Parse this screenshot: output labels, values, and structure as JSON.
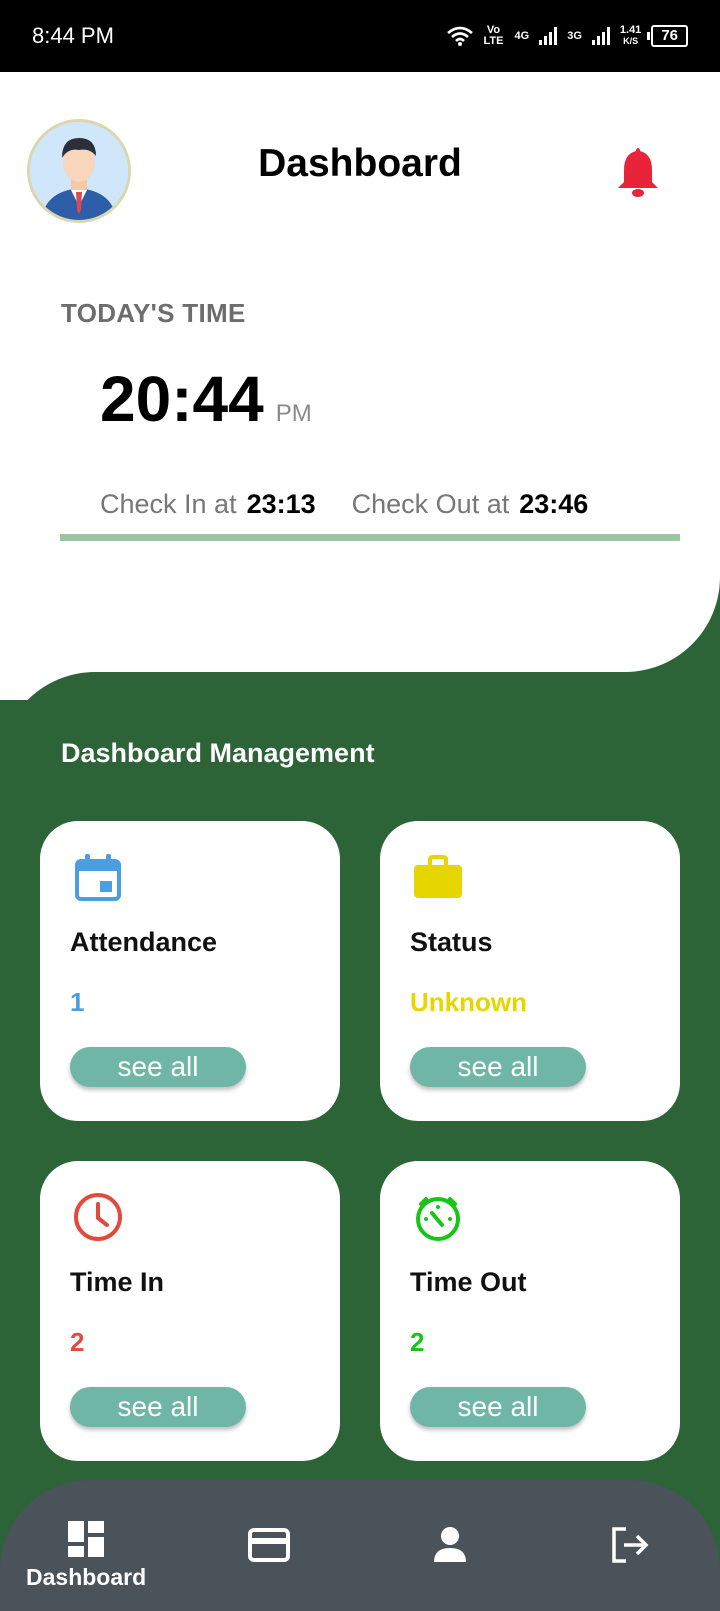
{
  "status_bar": {
    "time": "8:44 PM",
    "net1": "Vo LTE",
    "net2": "4G",
    "net3": "3G",
    "speed_value": "1.41",
    "speed_unit": "K/S",
    "battery": "76",
    "icons": [
      "wifi-icon",
      "signal-icon",
      "battery-icon"
    ]
  },
  "header": {
    "title": "Dashboard",
    "avatar": "user-avatar",
    "notification_icon": "bell-icon",
    "bell_color": "#e8233a"
  },
  "today": {
    "label": "TODAY'S TIME",
    "time": "20:44",
    "ampm": "PM",
    "check_in_label": "Check In at",
    "check_in_value": "23:13",
    "check_out_label": "Check Out at",
    "check_out_value": "23:46"
  },
  "section": {
    "title": "Dashboard Management"
  },
  "cards": [
    {
      "title": "Attendance",
      "value": "1",
      "button": "see all",
      "icon": "calendar-icon",
      "color": "#4a9fe0"
    },
    {
      "title": "Status",
      "value": "Unknown",
      "button": "see all",
      "icon": "briefcase-icon",
      "color": "#e6d600"
    },
    {
      "title": "Time In",
      "value": "2",
      "button": "see all",
      "icon": "clock-icon",
      "color": "#e24a3b"
    },
    {
      "title": "Time Out",
      "value": "2",
      "button": "see all",
      "icon": "timer-icon",
      "color": "#17c517"
    }
  ],
  "bottom_nav": {
    "items": [
      {
        "label": "Dashboard",
        "icon": "dashboard-icon",
        "active": true
      },
      {
        "label": "",
        "icon": "card-icon",
        "active": false
      },
      {
        "label": "",
        "icon": "person-icon",
        "active": false
      },
      {
        "label": "",
        "icon": "logout-icon",
        "active": false
      }
    ]
  },
  "colors": {
    "primary_green": "#2c6337",
    "button_teal": "#6fb6a7",
    "nav_bg": "#4a525a"
  }
}
